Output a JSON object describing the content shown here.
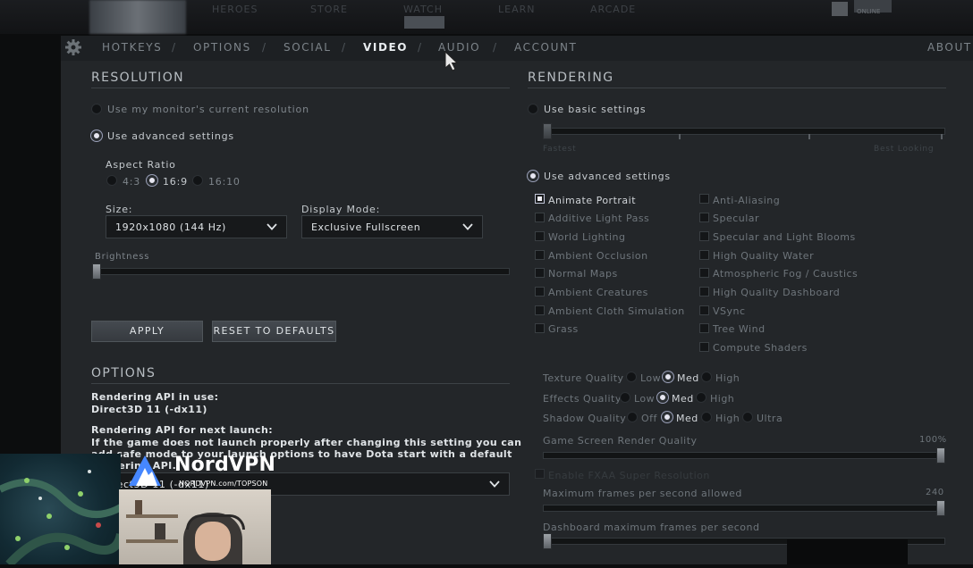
{
  "top_nav": {
    "items": [
      "HEROES",
      "STORE",
      "WATCH",
      "LEARN",
      "ARCADE"
    ],
    "badge": "ONLINE"
  },
  "tabs": [
    {
      "label": "HOTKEYS",
      "active": false
    },
    {
      "label": "OPTIONS",
      "active": false
    },
    {
      "label": "SOCIAL",
      "active": false
    },
    {
      "label": "VIDEO",
      "active": true
    },
    {
      "label": "AUDIO",
      "active": false
    },
    {
      "label": "ACCOUNT",
      "active": false
    }
  ],
  "tab_separator": "/",
  "about_label": "ABOUT",
  "resolution": {
    "title": "RESOLUTION",
    "use_monitor": "Use my monitor's current resolution",
    "use_advanced": "Use advanced settings",
    "aspect_ratio_label": "Aspect Ratio",
    "aspect_options": [
      "4:3",
      "16:9",
      "16:10"
    ],
    "aspect_selected": "16:9",
    "size_label": "Size:",
    "size_value": "1920x1080 (144 Hz)",
    "display_mode_label": "Display Mode:",
    "display_mode_value": "Exclusive Fullscreen",
    "brightness_label": "Brightness",
    "brightness_value": 0.0,
    "apply_button": "APPLY",
    "reset_button": "RESET TO DEFAULTS"
  },
  "options": {
    "title": "OPTIONS",
    "api_in_use_label": "Rendering API in use:",
    "api_in_use_value": "Direct3D 11 (-dx11)",
    "api_next_label": "Rendering API for next launch:",
    "api_note_lines": [
      "If the game does not launch properly after changing this setting you can",
      "add safe mode to your launch options to have Dota start with a default",
      "rendering API."
    ],
    "api_select_value": "Direct3D 11 (-dx11)"
  },
  "rendering": {
    "title": "RENDERING",
    "use_basic": "Use basic settings",
    "slider_left": "Fastest",
    "slider_right": "Best Looking",
    "use_advanced": "Use advanced settings",
    "checkboxes_left": [
      {
        "label": "Animate Portrait",
        "checked": true
      },
      {
        "label": "Additive Light Pass",
        "checked": false
      },
      {
        "label": "World Lighting",
        "checked": false
      },
      {
        "label": "Ambient Occlusion",
        "checked": false
      },
      {
        "label": "Normal Maps",
        "checked": false
      },
      {
        "label": "Ambient Creatures",
        "checked": false
      },
      {
        "label": "Ambient Cloth Simulation",
        "checked": false
      },
      {
        "label": "Grass",
        "checked": false
      }
    ],
    "checkboxes_right": [
      {
        "label": "Anti-Aliasing",
        "checked": false
      },
      {
        "label": "Specular",
        "checked": false
      },
      {
        "label": "Specular and Light Blooms",
        "checked": false
      },
      {
        "label": "High Quality Water",
        "checked": false
      },
      {
        "label": "Atmospheric Fog / Caustics",
        "checked": false
      },
      {
        "label": "High Quality Dashboard",
        "checked": false
      },
      {
        "label": "VSync",
        "checked": false
      },
      {
        "label": "Tree Wind",
        "checked": false
      },
      {
        "label": "Compute Shaders",
        "checked": false
      }
    ],
    "texture_quality": {
      "label": "Texture Quality",
      "options": [
        "Low",
        "Med",
        "High"
      ],
      "selected": "Med"
    },
    "effects_quality": {
      "label": "Effects Quality",
      "options": [
        "Low",
        "Med",
        "High"
      ],
      "selected": "Med"
    },
    "shadow_quality": {
      "label": "Shadow Quality",
      "options": [
        "Off",
        "Med",
        "High",
        "Ultra"
      ],
      "selected": "Med"
    },
    "render_quality_label": "Game Screen Render Quality",
    "render_quality_value": "100%",
    "render_quality_fraction": 1.0,
    "faded_checkbox_label": "Enable FXAA Super Resolution",
    "max_fps_label": "Maximum frames per second allowed",
    "max_fps_value": "240",
    "max_fps_fraction": 1.0,
    "dashboard_fps_label": "Dashboard maximum frames per second",
    "dashboard_fps_fraction": 0.0
  },
  "overlay": {
    "brand": "NordVPN",
    "url": "NORDVPN.com/TOPSON"
  },
  "colors": {
    "panel": "#232629",
    "accent": "#e6e6f0",
    "text": "#c8ccd0"
  }
}
